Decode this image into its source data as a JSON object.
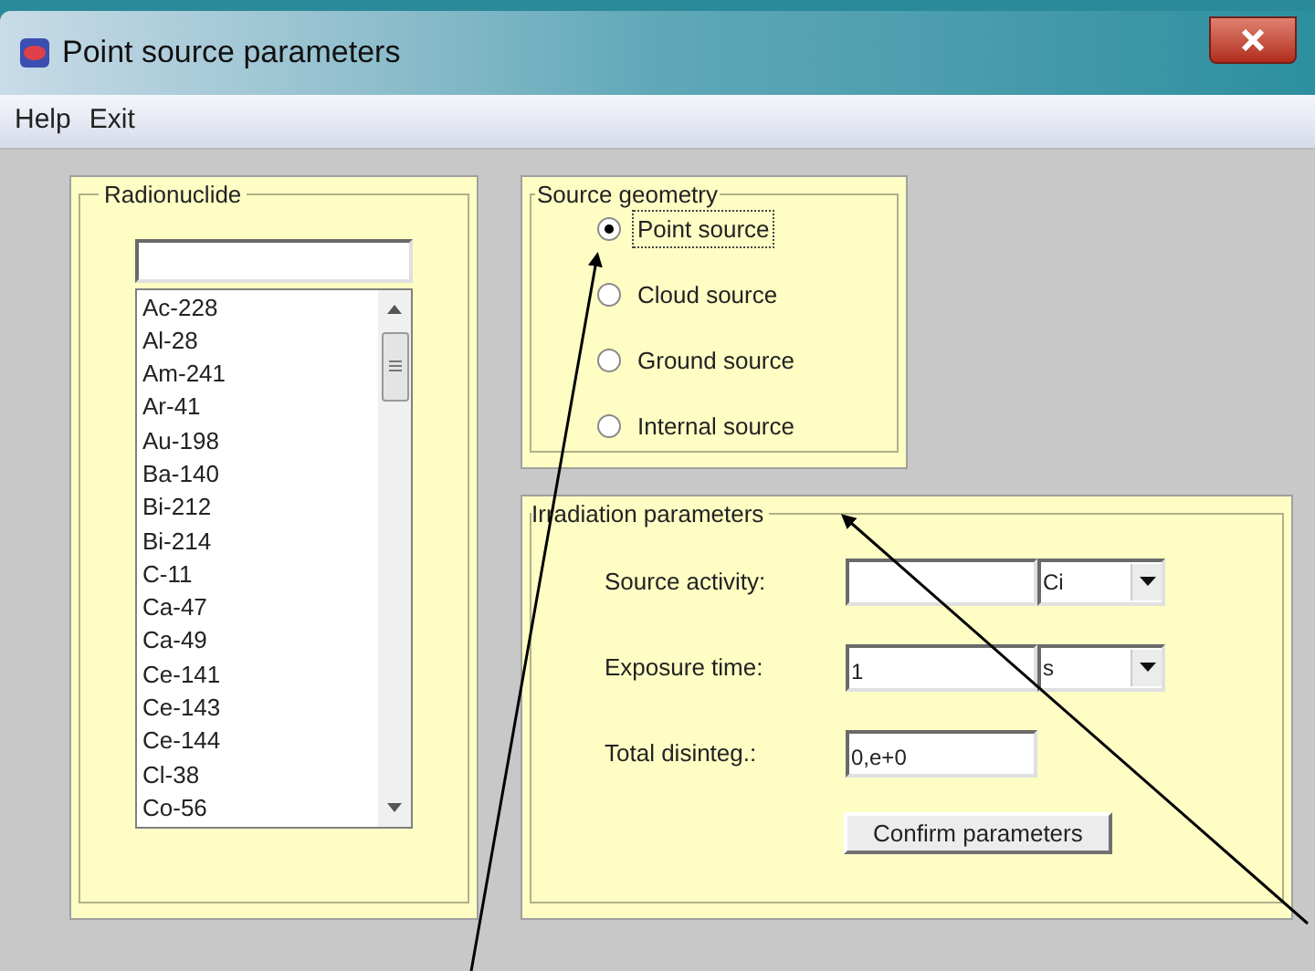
{
  "window": {
    "title": "Point source parameters"
  },
  "menu": [
    "Help",
    "Exit"
  ],
  "radionuclide": {
    "title": "Radionuclide",
    "items": [
      "Ac-228",
      "Al-28",
      "Am-241",
      "Ar-41",
      "Au-198",
      "Ba-140",
      "Bi-212",
      "Bi-214",
      "C-11",
      "Ca-47",
      "Ca-49",
      "Ce-141",
      "Ce-143",
      "Ce-144",
      "Cl-38",
      "Co-56"
    ]
  },
  "source_geometry": {
    "title": "Source geometry",
    "options": [
      {
        "label": "Point source",
        "selected": true
      },
      {
        "label": "Cloud source",
        "selected": false
      },
      {
        "label": "Ground source",
        "selected": false
      },
      {
        "label": "Internal source",
        "selected": false
      }
    ]
  },
  "irradiation": {
    "title": "Irradiation parameters",
    "fields": [
      {
        "label": "Source activity:",
        "unit": "Ci"
      },
      {
        "label": "Exposure time:",
        "value": "1",
        "unit": "s"
      },
      {
        "label": "Total disinteg.:",
        "value": "0,e+0"
      }
    ],
    "button": "Confirm parameters"
  }
}
